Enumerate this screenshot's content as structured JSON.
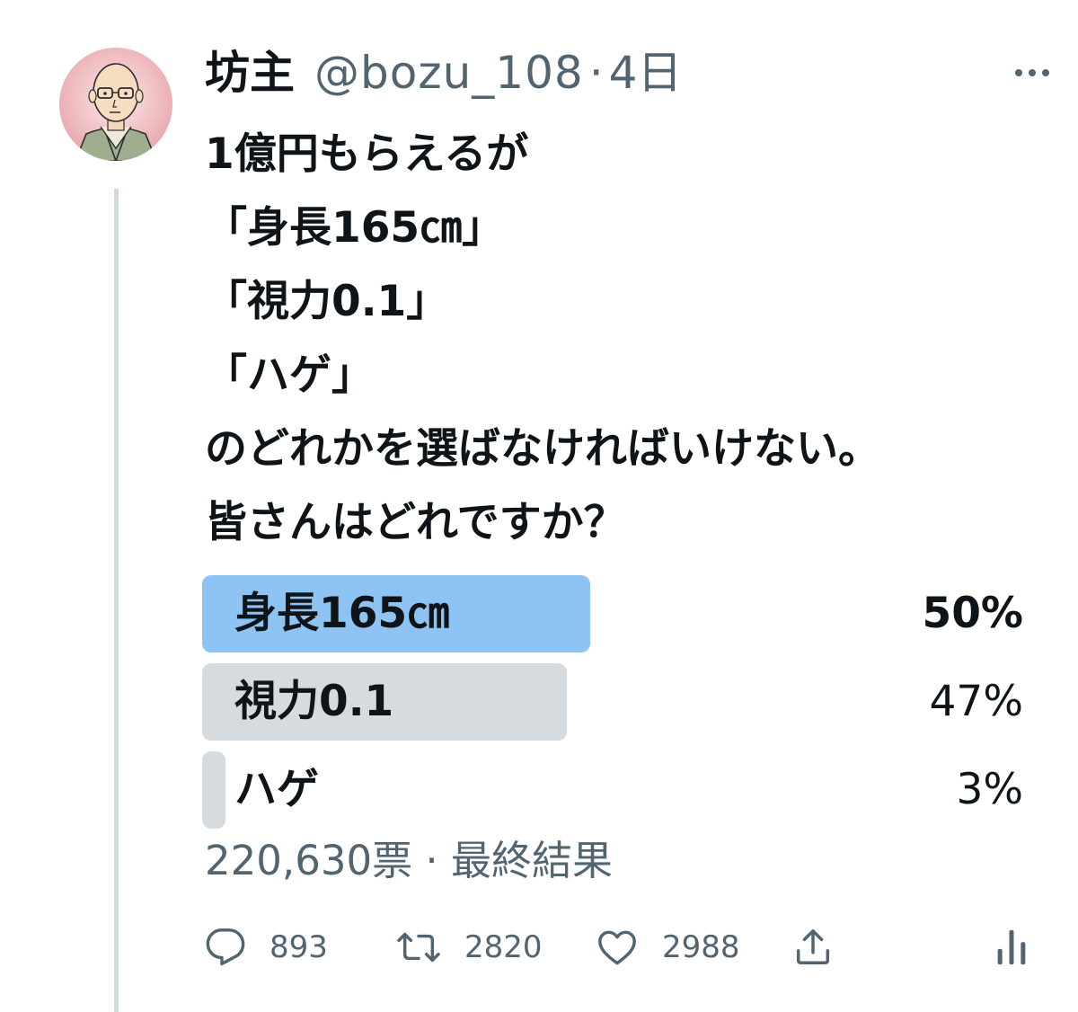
{
  "tweet": {
    "author": {
      "display_name": "坊主",
      "handle": "@bozu_108",
      "separator": "·",
      "time": "4日",
      "avatar_icon": "cartoon-monk-avatar"
    },
    "text_lines": [
      "1億円もらえるが",
      "「身長165㎝」",
      "「視力0.1」",
      "「ハゲ」",
      "のどれかを選ばなければいけない。",
      "皆さんはどれですか？"
    ],
    "more_icon": "more-horizontal-icon"
  },
  "poll": {
    "options": [
      {
        "label": "身長165㎝",
        "percent_text": "50%",
        "percent": 50,
        "winner": true
      },
      {
        "label": "視力0.1",
        "percent_text": "47%",
        "percent": 47,
        "winner": false
      },
      {
        "label": "ハゲ",
        "percent_text": "3%",
        "percent": 3,
        "winner": false
      }
    ],
    "summary": "220,630票 · 最終結果",
    "colors": {
      "winner_bar": "#8ec4f4",
      "other_bar": "#d6dbe0"
    }
  },
  "actions": {
    "reply": {
      "icon": "reply-icon",
      "count": "893"
    },
    "retweet": {
      "icon": "retweet-icon",
      "count": "2820"
    },
    "like": {
      "icon": "heart-icon",
      "count": "2988"
    },
    "share": {
      "icon": "share-icon"
    },
    "analytics": {
      "icon": "analytics-icon"
    }
  },
  "colors": {
    "text": "#0f1419",
    "secondary_text": "#536471",
    "thread_line": "#cfd9de"
  }
}
